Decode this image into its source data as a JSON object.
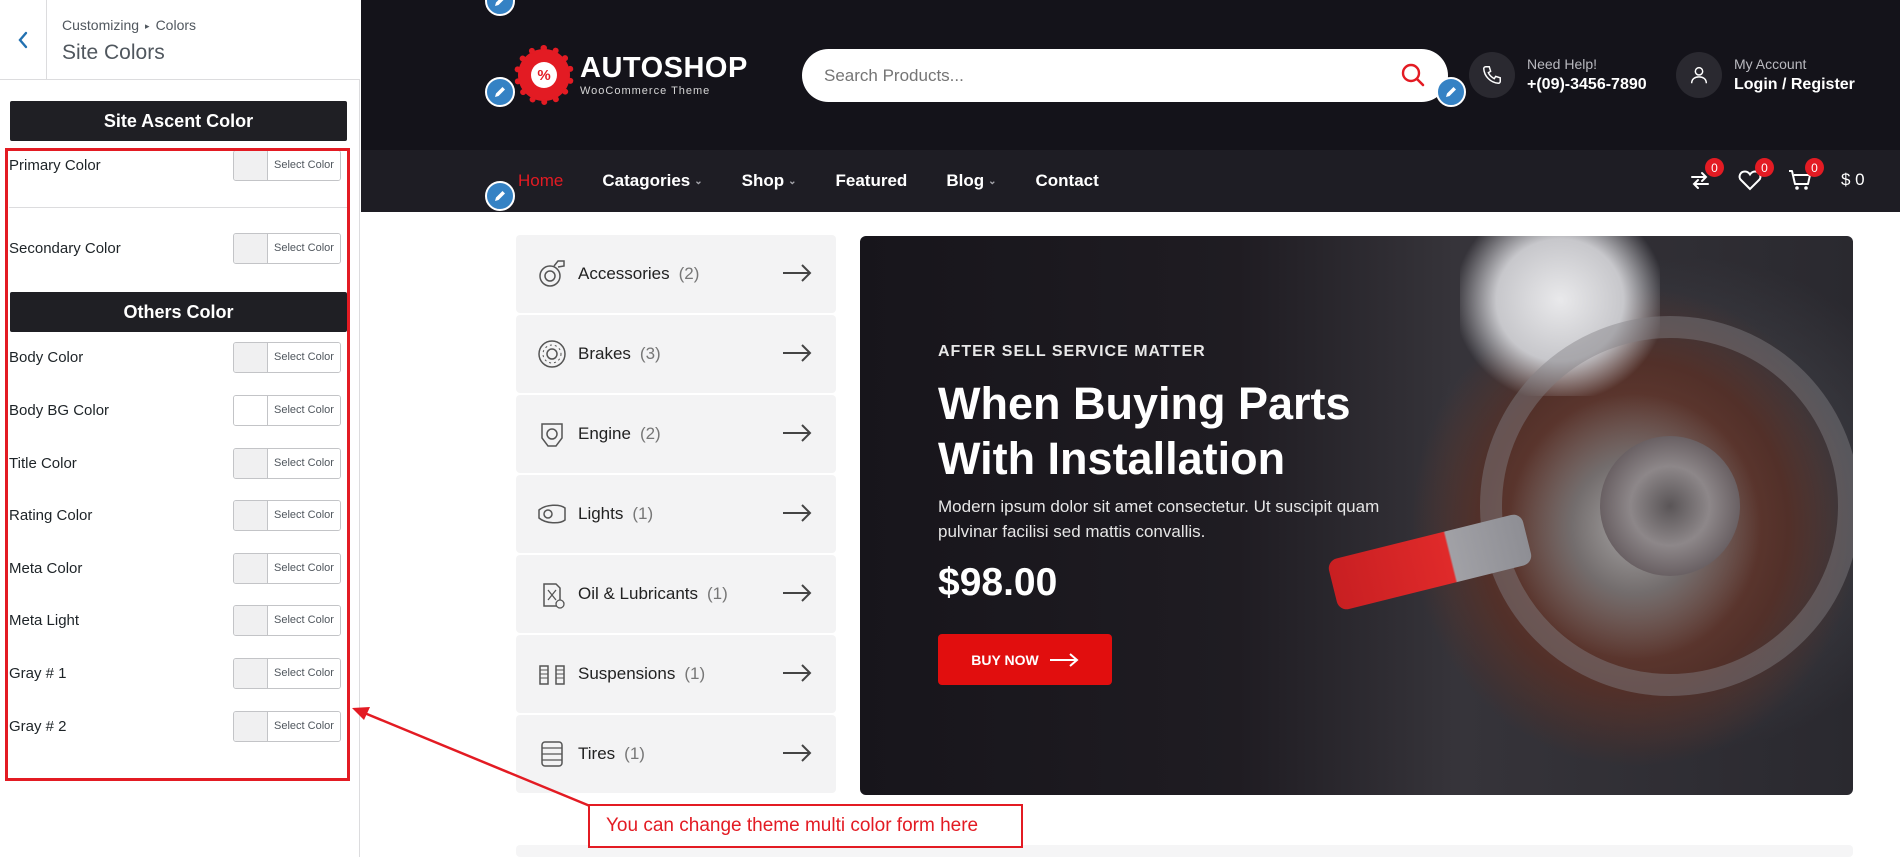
{
  "customizer": {
    "breadcrumb_root": "Customizing",
    "breadcrumb_sep": "▸",
    "breadcrumb_section": "Colors",
    "title": "Site Colors",
    "site_ascent_header": "Site Ascent Color",
    "others_header": "Others Color",
    "select_label": "Select Color",
    "ascent_colors": [
      {
        "label": "Primary Color"
      },
      {
        "label": "Secondary Color"
      }
    ],
    "other_colors": [
      {
        "label": "Body Color"
      },
      {
        "label": "Body BG Color"
      },
      {
        "label": "Title Color"
      },
      {
        "label": "Rating Color"
      },
      {
        "label": "Meta Color"
      },
      {
        "label": "Meta Light"
      },
      {
        "label": "Gray # 1"
      },
      {
        "label": "Gray # 2"
      }
    ]
  },
  "header": {
    "logo_name": "AUTOSHOP",
    "logo_sub": "WooCommerce Theme",
    "search_placeholder": "Search Products...",
    "help_label": "Need Help!",
    "help_phone": "+(09)-3456-7890",
    "account_label": "My Account",
    "account_action": "Login / Register"
  },
  "nav": {
    "items": [
      {
        "label": "Home",
        "active": true
      },
      {
        "label": "Catagories",
        "dropdown": true
      },
      {
        "label": "Shop",
        "dropdown": true
      },
      {
        "label": "Featured"
      },
      {
        "label": "Blog",
        "dropdown": true
      },
      {
        "label": "Contact"
      }
    ],
    "compare_count": "0",
    "wishlist_count": "0",
    "cart_count": "0",
    "cart_total": "$ 0"
  },
  "categories": [
    {
      "name": "Accessories",
      "count": "(2)",
      "icon": "turbo-icon"
    },
    {
      "name": "Brakes",
      "count": "(3)",
      "icon": "brake-disc-icon"
    },
    {
      "name": "Engine",
      "count": "(2)",
      "icon": "engine-icon"
    },
    {
      "name": "Lights",
      "count": "(1)",
      "icon": "headlight-icon"
    },
    {
      "name": "Oil & Lubricants",
      "count": "(1)",
      "icon": "oil-can-icon"
    },
    {
      "name": "Suspensions",
      "count": "(1)",
      "icon": "suspension-icon"
    },
    {
      "name": "Tires",
      "count": "(1)",
      "icon": "tire-icon"
    }
  ],
  "hero": {
    "eyebrow": "AFTER SELL SERVICE MATTER",
    "headline_1": "When Buying Parts",
    "headline_2": "With Installation",
    "description": "Modern ipsum dolor sit amet consectetur. Ut suscipit quam pulvinar facilisi sed mattis convallis.",
    "price": "$98.00",
    "button": "BUY NOW"
  },
  "annotation": {
    "text": "You can change theme multi color form here"
  },
  "colors": {
    "accent": "#e31b23",
    "dark": "#14131a",
    "customizer_link": "#2271b1",
    "edit_pin": "#3582c4"
  }
}
